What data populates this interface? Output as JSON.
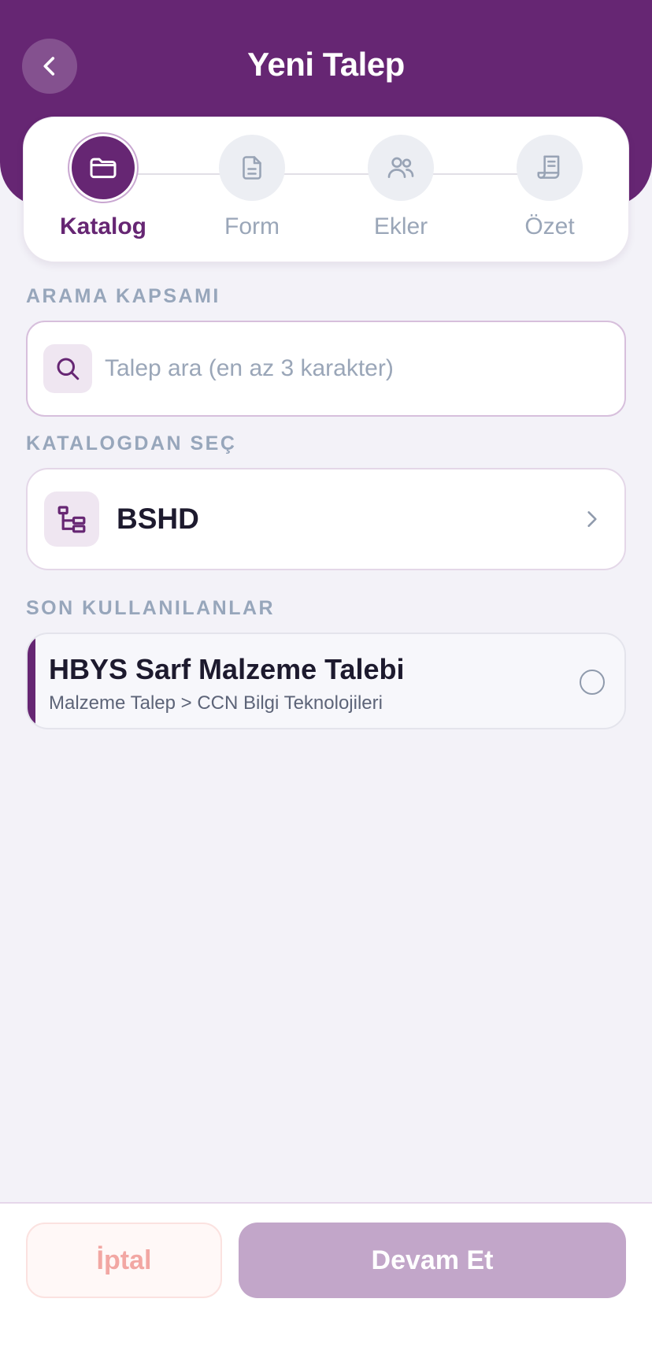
{
  "header": {
    "title": "Yeni Talep",
    "back_icon": "chevron-left-icon"
  },
  "stepper": {
    "active_index": 0,
    "steps": [
      {
        "label": "Katalog",
        "icon": "folder-icon"
      },
      {
        "label": "Form",
        "icon": "document-icon"
      },
      {
        "label": "Ekler",
        "icon": "users-icon"
      },
      {
        "label": "Özet",
        "icon": "receipt-icon"
      }
    ]
  },
  "search_section": {
    "label": "ARAMA KAPSAMI",
    "placeholder": "Talep ara (en az 3 karakter)",
    "value": ""
  },
  "catalog_section": {
    "label": "KATALOGDAN SEÇ",
    "item_label": "BSHD"
  },
  "recent_section": {
    "label": "SON KULLANILANLAR",
    "items": [
      {
        "title": "HBYS Sarf Malzeme Talebi",
        "subtitle": "Malzeme Talep > CCN Bilgi Teknolojileri",
        "selected": false
      }
    ]
  },
  "footer": {
    "cancel_label": "İptal",
    "continue_label": "Devam Et"
  },
  "colors": {
    "brand": "#662673",
    "background": "#f3f2f8",
    "muted_text": "#9aa6b8",
    "cancel_text": "#f2a7a3",
    "continue_disabled": "#c2a6c9"
  }
}
